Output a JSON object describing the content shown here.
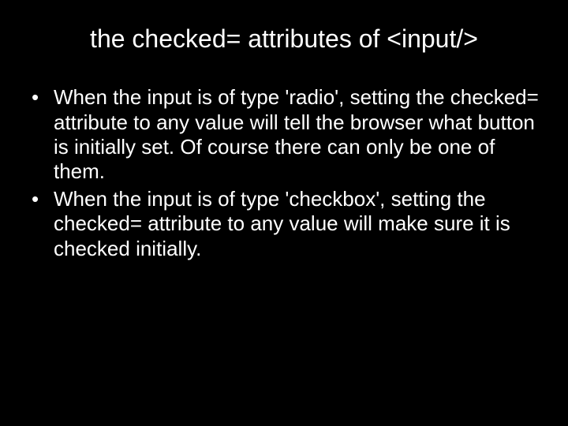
{
  "slide": {
    "title": "the checked= attributes of <input/>",
    "bullets": [
      "When the input is of type 'radio', setting the checked= attribute to any value will tell the browser what button is initially set. Of course there can only be one of them.",
      "When the input is of type 'checkbox', setting the checked= attribute to any value will make sure it is checked initially."
    ]
  }
}
